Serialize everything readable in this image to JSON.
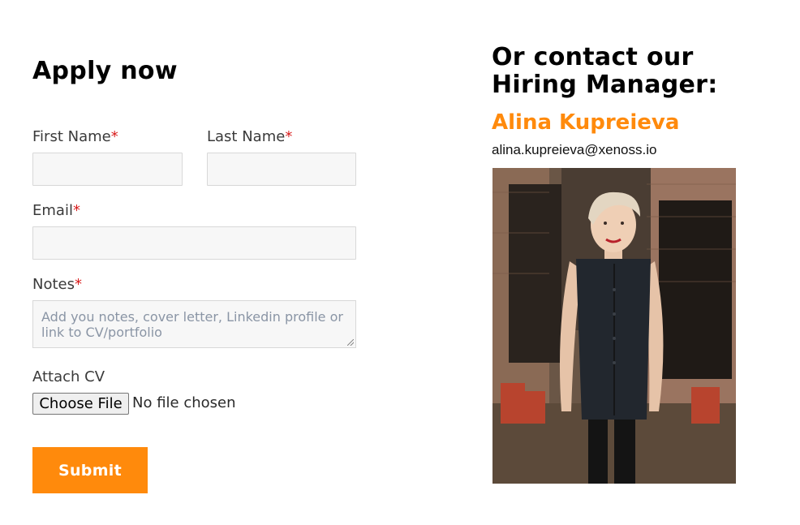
{
  "form": {
    "title": "Apply now",
    "first_name_label": "First Name",
    "last_name_label": "Last Name",
    "email_label": "Email",
    "notes_label": "Notes",
    "required_mark": "*",
    "notes_placeholder": "Add you notes, cover letter, Linkedin profile or link to CV/portfolio",
    "attach_label": "Attach CV",
    "choose_file_label": "Choose File",
    "file_status": "No file chosen",
    "submit_label": "Submit"
  },
  "contact": {
    "heading": "Or contact our Hiring Manager:",
    "manager_name": "Alina Kupreieva",
    "manager_email": "alina.kupreieva@xenoss.io"
  },
  "colors": {
    "accent": "#ff8a0c",
    "required": "#d81b1b",
    "field_bg": "#f7f7f7"
  }
}
